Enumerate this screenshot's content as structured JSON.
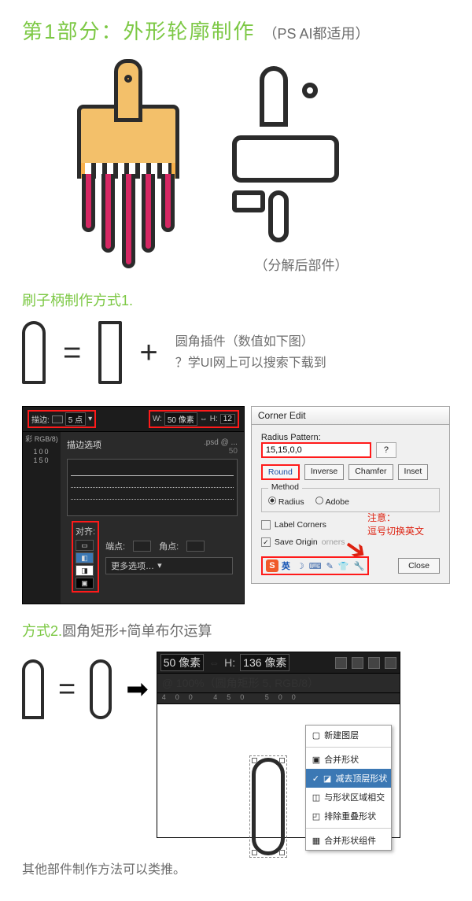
{
  "heading": {
    "part_label": "第1部分：",
    "part_title": "外形轮廓制作",
    "subtitle": "（PS AI都适用）"
  },
  "decompose_caption": "（分解后部件）",
  "method1": {
    "label": "刷子柄制作方式1.",
    "note_line1": "圆角插件（数值如下图）",
    "note_line2": "？学UI网上可以搜索下载到"
  },
  "ps_toolbar": {
    "stroke_label": "描边:",
    "stroke_value": "5 点",
    "w_label": "W:",
    "w_value": "50 像素",
    "link_icon": "⇔",
    "h_label": "H:",
    "h_value": "12"
  },
  "ps_sidebar": {
    "mode": "彩 RGB/8)",
    "ruler": "100  150"
  },
  "ps_panel": {
    "section": "描边选项",
    "align_label": "对齐:",
    "cap_label": "端点:",
    "corner_label": "角点:",
    "more": "更多选项…",
    "doc_tab": ".psd @ ...",
    "ruler2": "50"
  },
  "dialog": {
    "title": "Corner Edit",
    "pattern_label": "Radius Pattern:",
    "pattern_value": "15,15,0,0",
    "help": "?",
    "btn_round": "Round",
    "btn_inverse": "Inverse",
    "btn_chamfer": "Chamfer",
    "btn_inset": "Inset",
    "method_group": "Method",
    "radio_radius": "Radius",
    "radio_adobe": "Adobe",
    "label_corners": "Label Corners",
    "save_origin": "Save Origin",
    "save_origin_suffix": "orners",
    "btn_close": "Close",
    "ime_badge": "S",
    "ime_lang": "英",
    "ime_icons0": "☽",
    "ime_icons1": "⌨",
    "ime_icons2": "✎",
    "ime_icons3": "👕",
    "ime_icons4": "🔧",
    "note_line1": "注意：",
    "note_line2": "逗号切换英文"
  },
  "method2": {
    "label_prefix": "方式2.",
    "label_rest": "圆角矩形+简单布尔运算"
  },
  "ps_opt": {
    "w": "50 像素",
    "link": "⇔",
    "h_label": "H:",
    "h": "136 像素"
  },
  "ps_doc_tab": "@ 100%（圆角矩形 5, RGB/8）",
  "ps_ruler": "400        450        500",
  "bool_menu": {
    "new_layer": "新建图层",
    "union": "合并形状",
    "subtract": "减去顶层形状",
    "intersect": "与形状区域相交",
    "exclude": "排除重叠形状",
    "merge": "合并形状组件"
  },
  "footnote": "其他部件制作方法可以类推。"
}
